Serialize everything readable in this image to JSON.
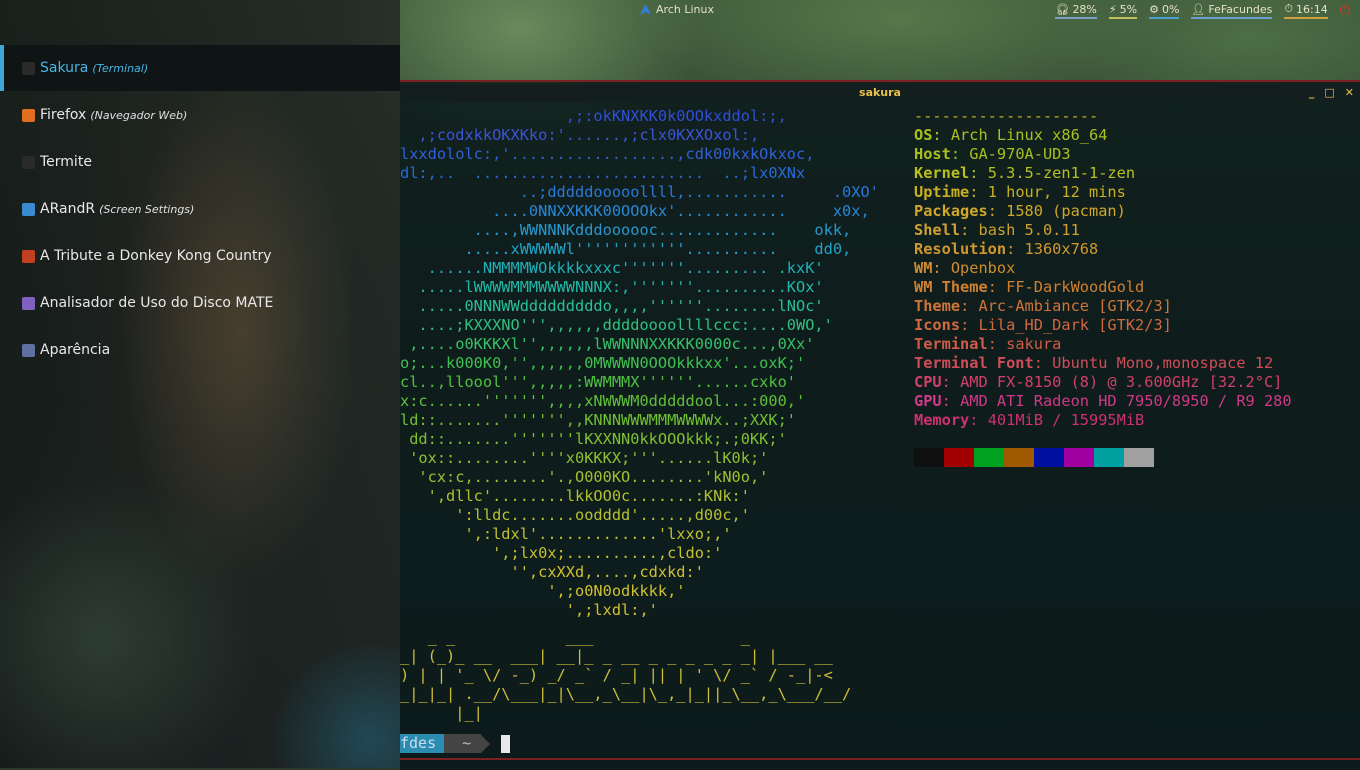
{
  "top_panel": {
    "wm_title": "Arch Linux",
    "tray": {
      "cpu": "28%",
      "battery": "5%",
      "network": "0%",
      "user": "FeFacundes",
      "clock": "16:14"
    }
  },
  "terminal": {
    "title": "sakura",
    "buttons": [
      "_",
      "□",
      "✕"
    ],
    "ascii": [
      {
        "t": "                  ,;:okKNXKK0k0OOkxddol:;,",
        "c": "#2f4fd8"
      },
      {
        "t": "  ,;codxkkOKXKko:'......,;clx0KXXOxol:,",
        "c": "#3a55d8"
      },
      {
        "t": "lxxdololc:,'..................,cdk00kxkOkxoc,",
        "c": "#3060d8"
      },
      {
        "t": "dl:,..  .........................  ..;lx0XNx",
        "c": "#2a6ad8"
      },
      {
        "t": "             ..;dddddooooollll,...........     .0XO'",
        "c": "#2878d8"
      },
      {
        "t": "          ....0NNXXKKK00OOOkx'............     x0x,",
        "c": "#2888d8"
      },
      {
        "t": "        ....,WWNNNKdddoooooc.............    okk,",
        "c": "#2898d0"
      },
      {
        "t": "       .....xWWWWWl''''''''''''..........    dd0,",
        "c": "#20a4c8"
      },
      {
        "t": "   ......NMMMMWOkkkkxxxc'''''''......... .kxK'",
        "c": "#20b0b8"
      },
      {
        "t": "  .....lWWWWMMMWWWWNNNX:,'''''''..........KOx'",
        "c": "#20b8a8"
      },
      {
        "t": "  .....0NNNWWdddddddddo,,,,''''''........lNOc'",
        "c": "#28c098"
      },
      {
        "t": "  ....;KXXXNO''',,,,,,ddddoooollllccc:....0WO,'",
        "c": "#30c080"
      },
      {
        "t": " ,....o0KKKXl'',,,,,,lWWNNNXXKKK0000c...,0Xx'",
        "c": "#38c068"
      },
      {
        "t": "o;...k000K0,'',,,,,,0MWWWN0OOOkkkxx'...oxK;'",
        "c": "#40c050"
      },
      {
        "t": "cl..,lloool''',,,,,:WWMMMX''''''......cxko'",
        "c": "#50c040"
      },
      {
        "t": "x:c......''''''',,,,xNWWWM0dddddool...:000,'",
        "c": "#60c038"
      },
      {
        "t": "ld::.......''''''',,KNNNWWWMMMWWWWx..;XXK;'",
        "c": "#70c030"
      },
      {
        "t": " dd::.......'''''''lKXXNN0kkOOOkkk;.;0KK;'",
        "c": "#80c030"
      },
      {
        "t": " 'ox::........''''x0KKKX;'''......lK0k;'",
        "c": "#90c030"
      },
      {
        "t": "  'cx:c,........'.,O000KO........'kN0o,'",
        "c": "#a0c030"
      },
      {
        "t": "   ',dllc'........lkkOO0c.......:KNk:'",
        "c": "#b0c030"
      },
      {
        "t": "      ':lldc.......oodddd'.....,d00c,'",
        "c": "#b8c030"
      },
      {
        "t": "       ',:ldxl'.............'lxxo;,'",
        "c": "#c0c030"
      },
      {
        "t": "          ',;lx0x;..........,cldo:'",
        "c": "#c8c030"
      },
      {
        "t": "            '',cxXXd,....,cdxkd:'",
        "c": "#d0c030"
      },
      {
        "t": "                ',;o0N0odkkkk,'",
        "c": "#d0c030"
      },
      {
        "t": "                  ',;lxdl:,'",
        "c": "#d0c030"
      }
    ],
    "banner": [
      "   _ _            ___                _",
      "_| (_)_ __  ___| __|_ _ __ _ _ _ _ _ _| |___ __",
      ") | | '_ \\/ -_) _/ _` / _| || | ' \\/ _` / -_|-<",
      "_|_|_| .__/\\___|_|\\__,_\\__|\\_,_|_||_\\__,_\\___/__/",
      "      |_|"
    ],
    "info": [
      {
        "k": "",
        "v": "--------------------",
        "c": "#c8b020"
      },
      {
        "k": "OS",
        "v": "Arch Linux x86_64",
        "c": "#a8c020"
      },
      {
        "k": "Host",
        "v": "GA-970A-UD3",
        "c": "#a8c020"
      },
      {
        "k": "Kernel",
        "v": "5.3.5-zen1-1-zen",
        "c": "#b8c020"
      },
      {
        "k": "Uptime",
        "v": "1 hour, 12 mins",
        "c": "#c8b020"
      },
      {
        "k": "Packages",
        "v": "1580 (pacman)",
        "c": "#d0a828"
      },
      {
        "k": "Shell",
        "v": "bash 5.0.11",
        "c": "#d0a030"
      },
      {
        "k": "Resolution",
        "v": "1360x768",
        "c": "#d09830"
      },
      {
        "k": "WM",
        "v": "Openbox",
        "c": "#d08c30"
      },
      {
        "k": "WM Theme",
        "v": "FF-DarkWoodGold",
        "c": "#d08030"
      },
      {
        "k": "Theme",
        "v": "Arc-Ambiance [GTK2/3]",
        "c": "#d07438"
      },
      {
        "k": "Icons",
        "v": "Lila_HD_Dark [GTK2/3]",
        "c": "#d06840"
      },
      {
        "k": "Terminal",
        "v": "sakura",
        "c": "#d05c48"
      },
      {
        "k": "Terminal Font",
        "v": "Ubuntu Mono,monospace 12",
        "c": "#d04c58"
      },
      {
        "k": "CPU",
        "v": "AMD FX-8150 (8) @ 3.600GHz [32.2°C]",
        "c": "#d04068"
      },
      {
        "k": "GPU",
        "v": "AMD ATI Radeon HD 7950/8950 / R9 280",
        "c": "#d03888"
      },
      {
        "k": "Memory",
        "v": "401MiB / 15995MiB",
        "c": "#d03070"
      }
    ],
    "palette": [
      "#101010",
      "#a00000",
      "#00a020",
      "#a05a00",
      "#0010a0",
      "#a000a0",
      "#00a0a0",
      "#a0a0a0"
    ],
    "prompt": {
      "user": "fdes",
      "dir": "~"
    }
  },
  "menu": {
    "items": [
      {
        "label": "Sakura",
        "sub": "(Terminal)",
        "icon": "terminal-icon",
        "color": "#2a2a2a"
      },
      {
        "label": "Firefox",
        "sub": "(Navegador Web)",
        "icon": "firefox-icon",
        "color": "#e07020"
      },
      {
        "label": "Termite",
        "sub": "",
        "icon": "terminal-icon",
        "color": "#2a2a2a"
      },
      {
        "label": "ARandR",
        "sub": "(Screen Settings)",
        "icon": "display-icon",
        "color": "#3a8ad0"
      },
      {
        "label": "A Tribute a Donkey Kong Country",
        "sub": "",
        "icon": "game-icon",
        "color": "#c04020"
      },
      {
        "label": "Analisador de Uso do Disco MATE",
        "sub": "",
        "icon": "disk-usage-icon",
        "color": "#8060c0"
      },
      {
        "label": "Aparência",
        "sub": "",
        "icon": "appearance-icon",
        "color": "#6070a0"
      }
    ]
  }
}
